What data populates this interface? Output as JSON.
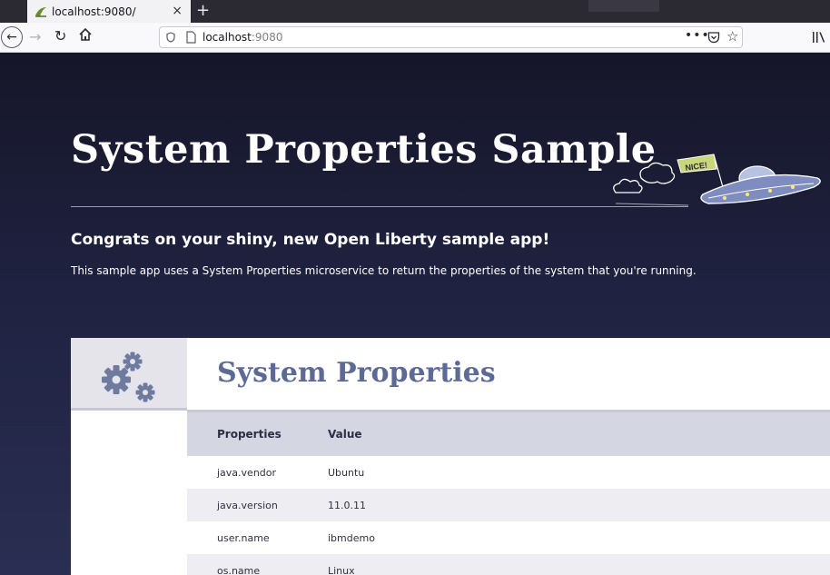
{
  "browser": {
    "tab_title": "localhost:9080/",
    "tab_close": "×",
    "new_tab": "+",
    "url_host": "localhost",
    "url_port": ":9080",
    "url_more": "•••"
  },
  "hero": {
    "title": "System Properties Sample",
    "congrats": "Congrats on your shiny, new Open Liberty sample app!",
    "description": "This sample app uses a System Properties microservice to return the properties of the system that you're running.",
    "ufo_flag": "NICE!"
  },
  "card": {
    "title": "System Properties",
    "columns": {
      "property": "Properties",
      "value": "Value"
    },
    "rows": [
      {
        "property": "java.vendor",
        "value": "Ubuntu"
      },
      {
        "property": "java.version",
        "value": "11.0.11"
      },
      {
        "property": "user.name",
        "value": "ibmdemo"
      },
      {
        "property": "os.name",
        "value": "Linux"
      }
    ]
  },
  "colors": {
    "page_bg": "#1b1b33",
    "card_title": "#5e6a96",
    "table_header": "#d4d6e2",
    "row_alt": "#eeeef2"
  }
}
